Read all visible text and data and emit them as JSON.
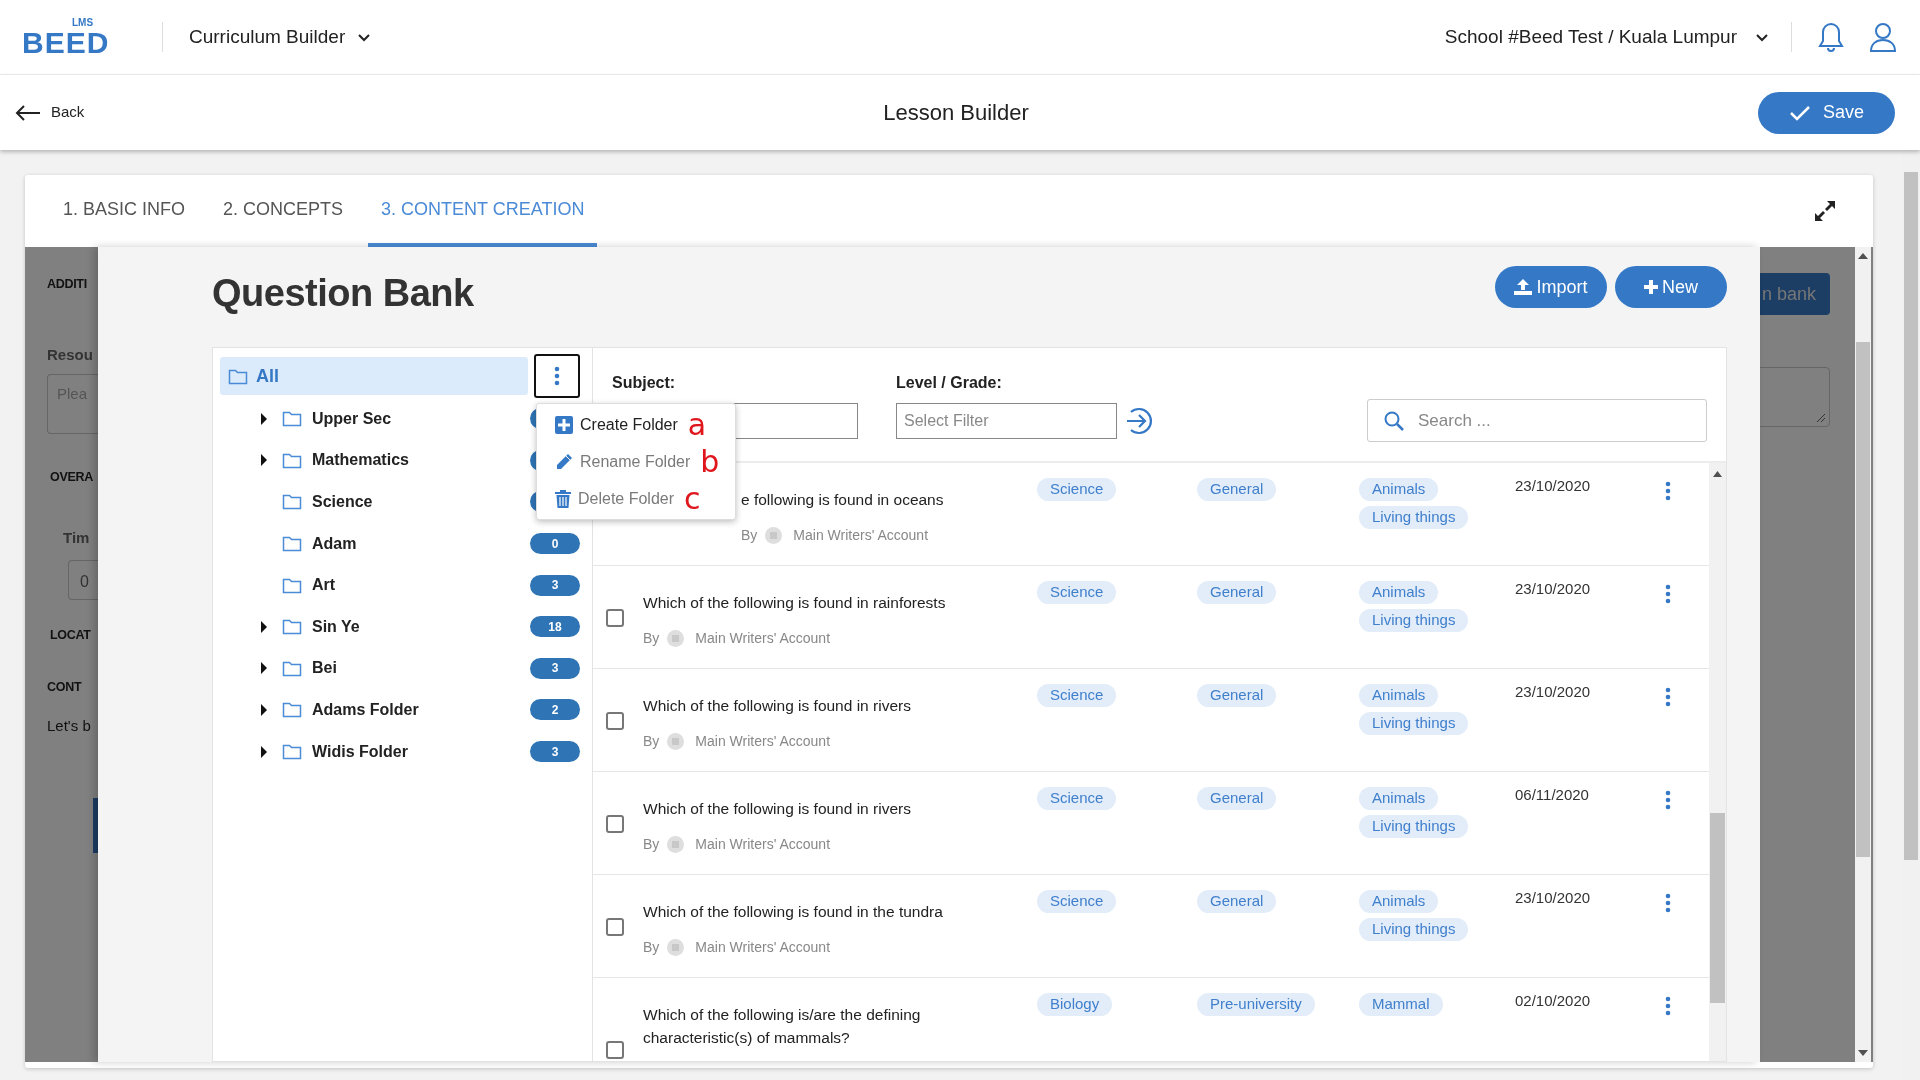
{
  "header": {
    "logo_superscript": "LMS",
    "logo_text": "BEED",
    "app_menu": "Curriculum Builder",
    "school": "School #Beed Test / Kuala Lumpur"
  },
  "toolbar": {
    "back": "Back",
    "title": "Lesson Builder",
    "save": "Save"
  },
  "tabs": [
    {
      "label": "1. BASIC INFO",
      "selected": false
    },
    {
      "label": "2. CONCEPTS",
      "selected": false
    },
    {
      "label": "3. CONTENT CREATION",
      "selected": true
    }
  ],
  "background_form": {
    "left": [
      {
        "kind": "heading",
        "text": "ADDITI"
      },
      {
        "kind": "label",
        "text": "Resou"
      },
      {
        "kind": "textarea",
        "placeholder": "Plea"
      },
      {
        "kind": "heading",
        "text": "OVERA"
      },
      {
        "kind": "label",
        "text": "Tim"
      },
      {
        "kind": "field",
        "value": "0"
      },
      {
        "kind": "heading",
        "text": "LOCAT"
      },
      {
        "kind": "heading",
        "text": "CONT"
      },
      {
        "kind": "text",
        "text": "Let's b"
      },
      {
        "kind": "button"
      }
    ],
    "right": [
      {
        "kind": "button",
        "text": "n bank"
      },
      {
        "kind": "textarea"
      }
    ]
  },
  "modal": {
    "title": "Question Bank",
    "buttons": [
      {
        "label": "Import",
        "kind": "import"
      },
      {
        "label": "New",
        "kind": "new"
      }
    ],
    "tree": {
      "root": {
        "label": "All",
        "selected": true
      },
      "items": [
        {
          "label": "Upper Sec",
          "expandable": true
        },
        {
          "label": "Mathematics",
          "expandable": true
        },
        {
          "label": "Science",
          "expandable": false
        },
        {
          "label": "Adam",
          "expandable": false,
          "count": "0"
        },
        {
          "label": "Art",
          "expandable": false,
          "count": "3"
        },
        {
          "label": "Sin Ye",
          "expandable": true,
          "count": "18"
        },
        {
          "label": "Bei",
          "expandable": true,
          "count": "3"
        },
        {
          "label": "Adams Folder",
          "expandable": true,
          "count": "2"
        },
        {
          "label": "Widis Folder",
          "expandable": true,
          "count": "3"
        }
      ]
    },
    "folder_menu": [
      {
        "label": "Create Folder",
        "kind": "create",
        "disabled": false,
        "annotation": "a"
      },
      {
        "label": "Rename Folder",
        "kind": "rename",
        "disabled": true,
        "annotation": "b"
      },
      {
        "label": "Delete Folder",
        "kind": "delete",
        "disabled": true,
        "annotation": "c"
      }
    ],
    "filters": {
      "subject_label": "Subject:",
      "level_label": "Level / Grade:",
      "level_placeholder": "Select Filter",
      "search_placeholder": "Search ..."
    },
    "questions": [
      {
        "question": "e following is found in oceans",
        "covered": true,
        "by": "By",
        "author": "Main Writers' Account",
        "subject": "Science",
        "level": "General",
        "topics": [
          "Animals",
          "Living things"
        ],
        "date": "23/10/2020"
      },
      {
        "question": "Which of the following is found in rainforests",
        "covered": false,
        "checked": false,
        "by": "By",
        "author": "Main Writers' Account",
        "subject": "Science",
        "level": "General",
        "topics": [
          "Animals",
          "Living things"
        ],
        "date": "23/10/2020"
      },
      {
        "question": "Which of the following is found in rivers",
        "covered": false,
        "checked": false,
        "by": "By",
        "author": "Main Writers' Account",
        "subject": "Science",
        "level": "General",
        "topics": [
          "Animals",
          "Living things"
        ],
        "date": "23/10/2020"
      },
      {
        "question": "Which of the following is found in rivers",
        "covered": false,
        "checked": false,
        "by": "By",
        "author": "Main Writers' Account",
        "subject": "Science",
        "level": "General",
        "topics": [
          "Animals",
          "Living things"
        ],
        "date": "06/11/2020"
      },
      {
        "question": "Which of the following is found in the tundra",
        "covered": false,
        "checked": false,
        "by": "By",
        "author": "Main Writers' Account",
        "subject": "Science",
        "level": "General",
        "topics": [
          "Animals",
          "Living things"
        ],
        "date": "23/10/2020"
      },
      {
        "question": "Which of the following is/are the defining characteristic(s) of mammals?",
        "covered": false,
        "checked": false,
        "subject": "Biology",
        "level": "Pre-university",
        "topics": [
          "Mammal"
        ],
        "date": "02/10/2020"
      }
    ]
  }
}
